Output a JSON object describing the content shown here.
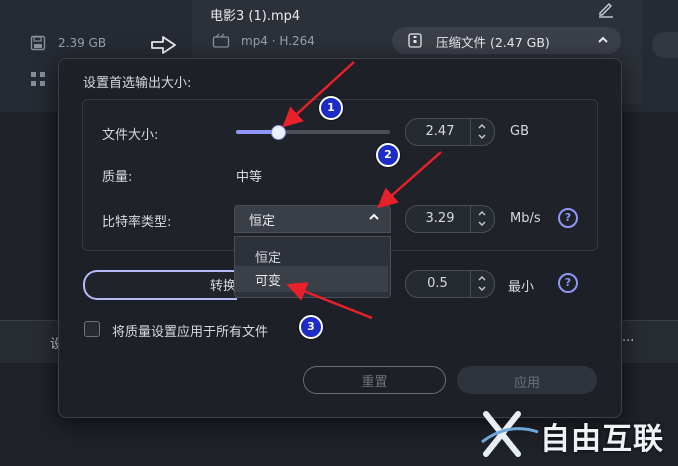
{
  "background": {
    "file_name": "电影3 (1).mp4",
    "file_size": "2.39 GB",
    "format": "mp4 · H.264",
    "compress_label": "压缩文件 (2.47 GB)",
    "tab_left_fragment": "设",
    "tab_right_fragment": "..."
  },
  "dialog": {
    "title": "设置首选输出大小:",
    "file_size_label": "文件大小:",
    "file_size_value": "2.47",
    "file_size_unit": "GB",
    "file_size_slider_fraction": 0.27,
    "quality_label": "质量:",
    "quality_value": "中等",
    "bitrate_type_label": "比特率类型:",
    "bitrate_type_selected": "恒定",
    "bitrate_value": "3.29",
    "bitrate_unit": "Mb/s",
    "bitrate_options": [
      "恒定",
      "可变"
    ],
    "convert_label": "转换",
    "min_value": "0.5",
    "min_label": "最小",
    "help_glyph": "?",
    "apply_all_label": "将质量设置应用于所有文件",
    "reset_label": "重置",
    "apply_label": "应用"
  },
  "annotations": {
    "badges": [
      "1",
      "2",
      "3"
    ],
    "arrow_color": "#e8202a"
  },
  "watermark": {
    "text": "自由互联"
  },
  "colors": {
    "accent": "#8f96f5",
    "dialog_bg": "#1d2027",
    "badge_bg": "#1d2cc6"
  }
}
